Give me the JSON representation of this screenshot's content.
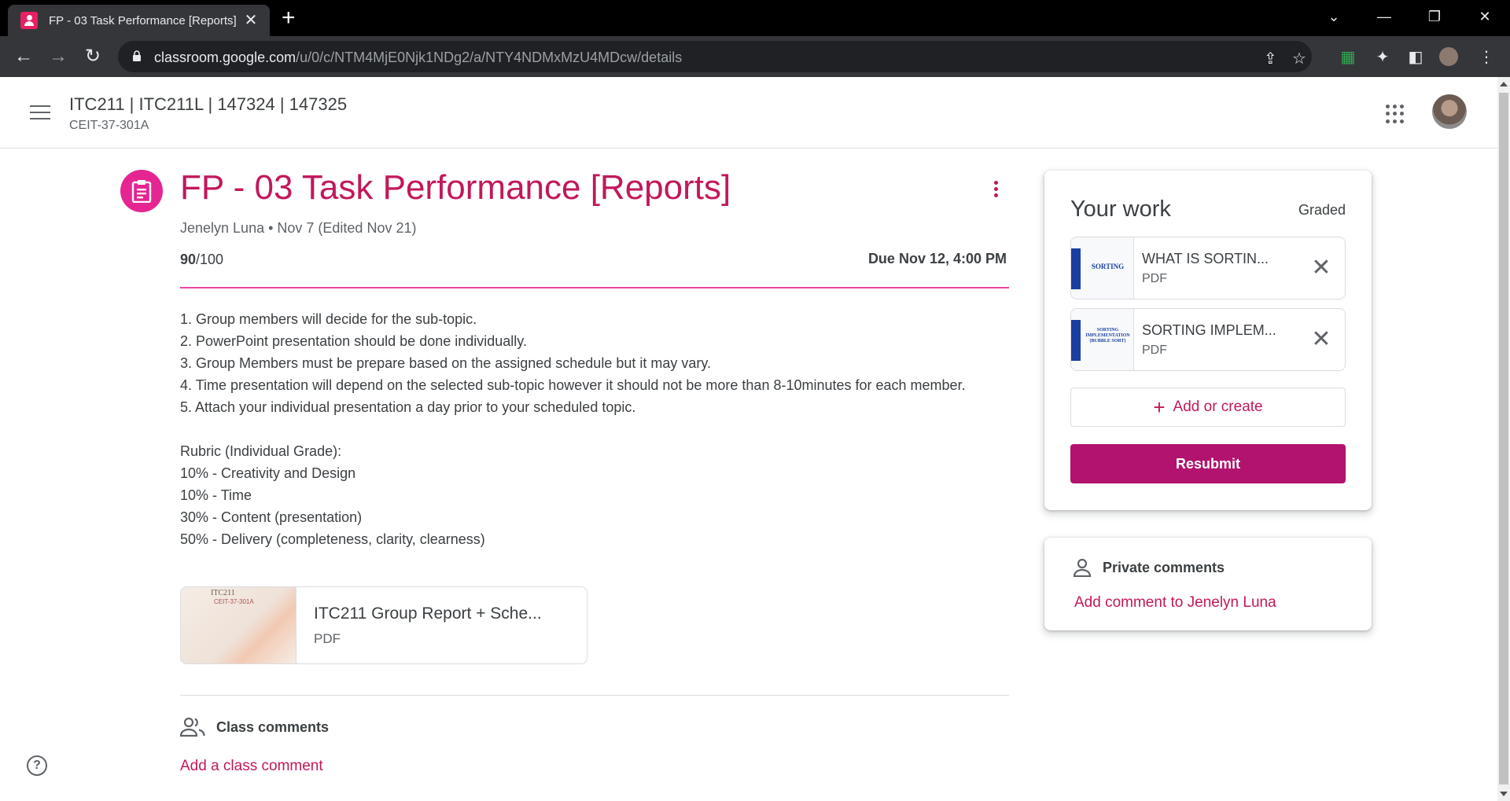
{
  "browser": {
    "tab_title": "FP - 03 Task Performance [Reports]",
    "url_host": "classroom.google.com",
    "url_path": "/u/0/c/NTM4MjE0Njk1NDg2/a/NTY4NDMxMzU4MDcw/details"
  },
  "header": {
    "class_title": "ITC211 | ITC211L | 147324 | 147325",
    "class_section": "CEIT-37-301A"
  },
  "assignment": {
    "title": "FP - 03 Task Performance [Reports]",
    "meta": "Jenelyn Luna • Nov 7 (Edited Nov 21)",
    "points_earned": "90",
    "points_total": "/100",
    "due": "Due Nov 12, 4:00 PM",
    "instructions": [
      "1. Group members will decide for the sub-topic.",
      "2. PowerPoint presentation should be done individually.",
      "3. Group Members must be prepare based on the assigned schedule but it may vary.",
      "4. Time presentation will depend on the selected sub-topic however it should not be more than 8-10minutes for each member.",
      "5. Attach your individual presentation a day prior to your scheduled topic.",
      "",
      "Rubric (Individual Grade):",
      "10% - Creativity and Design",
      "10% - Time",
      "30% - Content (presentation)",
      "50% - Delivery (completeness, clarity, clearness)"
    ],
    "attachment": {
      "name": "ITC211 Group Report + Sche...",
      "type": "PDF",
      "thumb_heading": "ITC211",
      "thumb_sub": "CEIT-37-301A"
    },
    "class_comments_label": "Class comments",
    "add_class_comment": "Add a class comment"
  },
  "your_work": {
    "title": "Your work",
    "status": "Graded",
    "files": [
      {
        "name": "WHAT IS SORTIN...",
        "type": "PDF",
        "thumb_text": "SORTING"
      },
      {
        "name": "SORTING IMPLEM...",
        "type": "PDF",
        "thumb_text": "SORTING IMPLEMENTATION (BUBBLE SORT)"
      }
    ],
    "add_or_create": "Add or create",
    "resubmit": "Resubmit"
  },
  "private_comments": {
    "label": "Private comments",
    "add": "Add comment to Jenelyn Luna"
  },
  "colors": {
    "accent": "#c2185b",
    "resubmit_bg": "#b1136e",
    "icon_bg": "#e52592"
  }
}
